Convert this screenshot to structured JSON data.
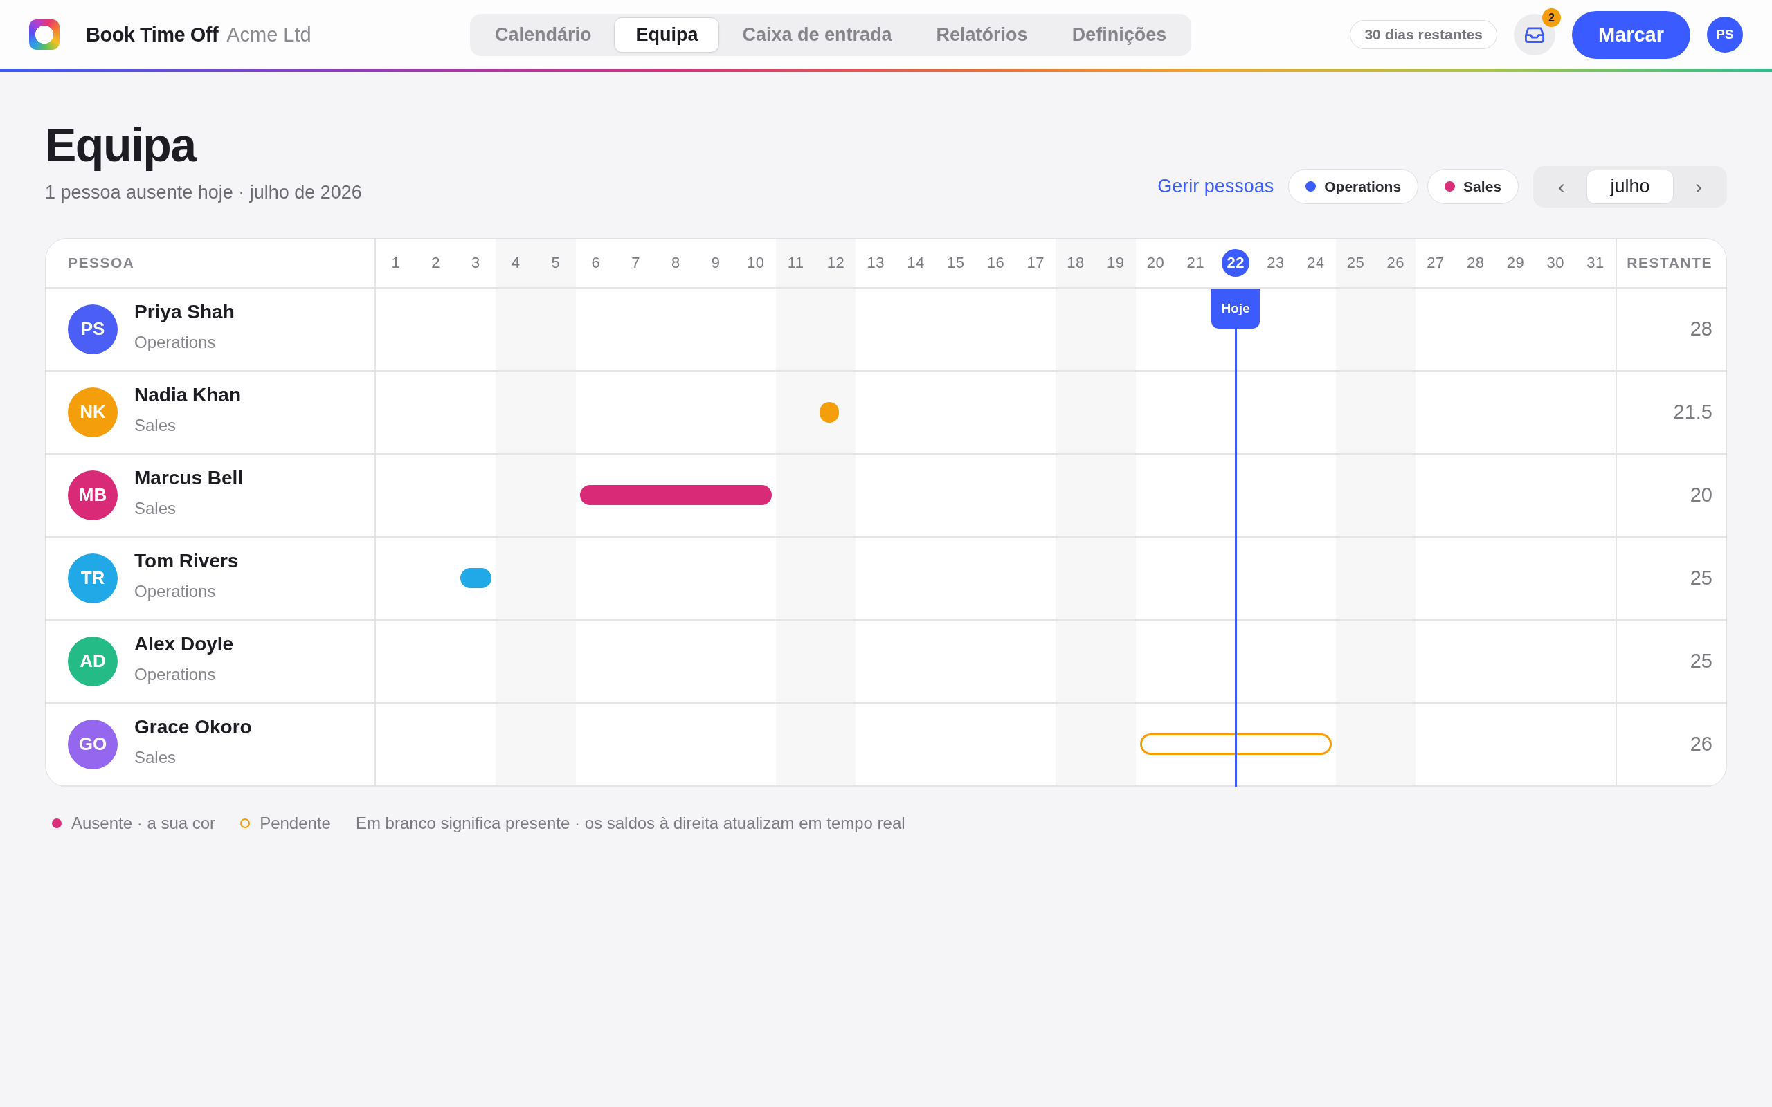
{
  "app": {
    "name": "Book Time Off",
    "org": "Acme Ltd"
  },
  "tabs": [
    {
      "label": "Calendário",
      "selected": false
    },
    {
      "label": "Equipa",
      "selected": true
    },
    {
      "label": "Caixa de entrada",
      "selected": false
    },
    {
      "label": "Relatórios",
      "selected": false
    },
    {
      "label": "Definições",
      "selected": false
    }
  ],
  "days_left": "30 dias restantes",
  "inbox": {
    "badge": "2"
  },
  "primary_action": "Marcar",
  "user": {
    "initials": "PS"
  },
  "page": {
    "title": "Equipa",
    "subtitle": "1 pessoa ausente hoje · julho de 2026"
  },
  "manage_link": "Gerir pessoas",
  "filters": [
    {
      "label": "Operations",
      "color": "#3b5bfd"
    },
    {
      "label": "Sales",
      "color": "#d92f7a"
    }
  ],
  "month_nav": {
    "prev": "‹",
    "month": "julho",
    "next": "›"
  },
  "table": {
    "person_header": "PESSOA",
    "remaining_header": "RESTANTE",
    "today_label": "Hoje"
  },
  "days": [
    {
      "label": "1",
      "weekend": false,
      "today": false
    },
    {
      "label": "2",
      "weekend": false,
      "today": false
    },
    {
      "label": "3",
      "weekend": false,
      "today": false
    },
    {
      "label": "4",
      "weekend": true,
      "today": false
    },
    {
      "label": "5",
      "weekend": true,
      "today": false
    },
    {
      "label": "6",
      "weekend": false,
      "today": false
    },
    {
      "label": "7",
      "weekend": false,
      "today": false
    },
    {
      "label": "8",
      "weekend": false,
      "today": false
    },
    {
      "label": "9",
      "weekend": false,
      "today": false
    },
    {
      "label": "10",
      "weekend": false,
      "today": false
    },
    {
      "label": "11",
      "weekend": true,
      "today": false
    },
    {
      "label": "12",
      "weekend": true,
      "today": false
    },
    {
      "label": "13",
      "weekend": false,
      "today": false
    },
    {
      "label": "14",
      "weekend": false,
      "today": false
    },
    {
      "label": "15",
      "weekend": false,
      "today": false
    },
    {
      "label": "16",
      "weekend": false,
      "today": false
    },
    {
      "label": "17",
      "weekend": false,
      "today": false
    },
    {
      "label": "18",
      "weekend": true,
      "today": false
    },
    {
      "label": "19",
      "weekend": true,
      "today": false
    },
    {
      "label": "20",
      "weekend": false,
      "today": false
    },
    {
      "label": "21",
      "weekend": false,
      "today": false
    },
    {
      "label": "22",
      "weekend": false,
      "today": true
    },
    {
      "label": "23",
      "weekend": false,
      "today": false
    },
    {
      "label": "24",
      "weekend": false,
      "today": false
    },
    {
      "label": "25",
      "weekend": true,
      "today": false
    },
    {
      "label": "26",
      "weekend": true,
      "today": false
    },
    {
      "label": "27",
      "weekend": false,
      "today": false
    },
    {
      "label": "28",
      "weekend": false,
      "today": false
    },
    {
      "label": "29",
      "weekend": false,
      "today": false
    },
    {
      "label": "30",
      "weekend": false,
      "today": false
    },
    {
      "label": "31",
      "weekend": false,
      "today": false
    }
  ],
  "people": [
    {
      "initials": "PS",
      "name": "Priya Shah",
      "department": "Operations",
      "color": "#4b5ef5",
      "remaining": "28",
      "timeline": [
        {
          "kind": "free"
        },
        {
          "kind": "free"
        },
        {
          "kind": "free"
        },
        {
          "kind": "free"
        },
        {
          "kind": "free"
        },
        {
          "kind": "free"
        },
        {
          "kind": "free"
        },
        {
          "kind": "free"
        },
        {
          "kind": "free"
        },
        {
          "kind": "free"
        },
        {
          "kind": "free"
        },
        {
          "kind": "free"
        },
        {
          "kind": "free"
        },
        {
          "kind": "free"
        },
        {
          "kind": "free"
        },
        {
          "kind": "free"
        },
        {
          "kind": "free"
        },
        {
          "kind": "free"
        },
        {
          "kind": "free"
        },
        {
          "kind": "free"
        },
        {
          "kind": "free"
        },
        {
          "kind": "free"
        },
        {
          "kind": "free"
        },
        {
          "kind": "free"
        },
        {
          "kind": "free"
        },
        {
          "kind": "free"
        },
        {
          "kind": "free"
        },
        {
          "kind": "free"
        },
        {
          "kind": "free"
        },
        {
          "kind": "free"
        },
        {
          "kind": "free"
        }
      ]
    },
    {
      "initials": "NK",
      "name": "Nadia Khan",
      "department": "Sales",
      "color": "#f59e0b",
      "remaining": "21.5",
      "timeline": [
        {
          "kind": "free"
        },
        {
          "kind": "free"
        },
        {
          "kind": "free"
        },
        {
          "kind": "free"
        },
        {
          "kind": "free"
        },
        {
          "kind": "free"
        },
        {
          "kind": "free"
        },
        {
          "kind": "free"
        },
        {
          "kind": "free"
        },
        {
          "kind": "free"
        },
        {
          "kind": "free"
        },
        {
          "kind": "half"
        },
        {
          "kind": "free"
        },
        {
          "kind": "free"
        },
        {
          "kind": "free"
        },
        {
          "kind": "free"
        },
        {
          "kind": "free"
        },
        {
          "kind": "free"
        },
        {
          "kind": "free"
        },
        {
          "kind": "free"
        },
        {
          "kind": "free"
        },
        {
          "kind": "free"
        },
        {
          "kind": "free"
        },
        {
          "kind": "free"
        },
        {
          "kind": "free"
        },
        {
          "kind": "free"
        },
        {
          "kind": "free"
        },
        {
          "kind": "free"
        },
        {
          "kind": "free"
        },
        {
          "kind": "free"
        },
        {
          "kind": "free"
        }
      ]
    },
    {
      "initials": "MB",
      "name": "Marcus Bell",
      "department": "Sales",
      "color": "#d92a78",
      "remaining": "20",
      "timeline": [
        {
          "kind": "free"
        },
        {
          "kind": "free"
        },
        {
          "kind": "free"
        },
        {
          "kind": "free"
        },
        {
          "kind": "free"
        },
        {
          "kind": "absent"
        },
        {
          "kind": "absent"
        },
        {
          "kind": "absent"
        },
        {
          "kind": "absent"
        },
        {
          "kind": "absent"
        },
        {
          "kind": "free"
        },
        {
          "kind": "free"
        },
        {
          "kind": "free"
        },
        {
          "kind": "free"
        },
        {
          "kind": "free"
        },
        {
          "kind": "free"
        },
        {
          "kind": "free"
        },
        {
          "kind": "free"
        },
        {
          "kind": "free"
        },
        {
          "kind": "free"
        },
        {
          "kind": "free"
        },
        {
          "kind": "free"
        },
        {
          "kind": "free"
        },
        {
          "kind": "free"
        },
        {
          "kind": "free"
        },
        {
          "kind": "free"
        },
        {
          "kind": "free"
        },
        {
          "kind": "free"
        },
        {
          "kind": "free"
        },
        {
          "kind": "free"
        },
        {
          "kind": "free"
        }
      ]
    },
    {
      "initials": "TR",
      "name": "Tom Rivers",
      "department": "Operations",
      "color": "#21a8e6",
      "remaining": "25",
      "timeline": [
        {
          "kind": "free"
        },
        {
          "kind": "free"
        },
        {
          "kind": "absent"
        },
        {
          "kind": "free"
        },
        {
          "kind": "free"
        },
        {
          "kind": "free"
        },
        {
          "kind": "free"
        },
        {
          "kind": "free"
        },
        {
          "kind": "free"
        },
        {
          "kind": "free"
        },
        {
          "kind": "free"
        },
        {
          "kind": "free"
        },
        {
          "kind": "free"
        },
        {
          "kind": "free"
        },
        {
          "kind": "free"
        },
        {
          "kind": "free"
        },
        {
          "kind": "free"
        },
        {
          "kind": "free"
        },
        {
          "kind": "free"
        },
        {
          "kind": "free"
        },
        {
          "kind": "free"
        },
        {
          "kind": "free"
        },
        {
          "kind": "free"
        },
        {
          "kind": "free"
        },
        {
          "kind": "free"
        },
        {
          "kind": "free"
        },
        {
          "kind": "free"
        },
        {
          "kind": "free"
        },
        {
          "kind": "free"
        },
        {
          "kind": "free"
        },
        {
          "kind": "free"
        }
      ]
    },
    {
      "initials": "AD",
      "name": "Alex Doyle",
      "department": "Operations",
      "color": "#25bb87",
      "remaining": "25",
      "timeline": [
        {
          "kind": "free"
        },
        {
          "kind": "free"
        },
        {
          "kind": "free"
        },
        {
          "kind": "free"
        },
        {
          "kind": "free"
        },
        {
          "kind": "free"
        },
        {
          "kind": "free"
        },
        {
          "kind": "free"
        },
        {
          "kind": "free"
        },
        {
          "kind": "free"
        },
        {
          "kind": "free"
        },
        {
          "kind": "free"
        },
        {
          "kind": "free"
        },
        {
          "kind": "free"
        },
        {
          "kind": "free"
        },
        {
          "kind": "free"
        },
        {
          "kind": "free"
        },
        {
          "kind": "free"
        },
        {
          "kind": "free"
        },
        {
          "kind": "free"
        },
        {
          "kind": "free"
        },
        {
          "kind": "free"
        },
        {
          "kind": "free"
        },
        {
          "kind": "free"
        },
        {
          "kind": "free"
        },
        {
          "kind": "free"
        },
        {
          "kind": "free"
        },
        {
          "kind": "free"
        },
        {
          "kind": "free"
        },
        {
          "kind": "free"
        },
        {
          "kind": "free"
        }
      ]
    },
    {
      "initials": "GO",
      "name": "Grace Okoro",
      "department": "Sales",
      "color": "#9566ee",
      "remaining": "26",
      "timeline": [
        {
          "kind": "free"
        },
        {
          "kind": "free"
        },
        {
          "kind": "free"
        },
        {
          "kind": "free"
        },
        {
          "kind": "free"
        },
        {
          "kind": "free"
        },
        {
          "kind": "free"
        },
        {
          "kind": "free"
        },
        {
          "kind": "free"
        },
        {
          "kind": "free"
        },
        {
          "kind": "free"
        },
        {
          "kind": "free"
        },
        {
          "kind": "free"
        },
        {
          "kind": "free"
        },
        {
          "kind": "free"
        },
        {
          "kind": "free"
        },
        {
          "kind": "free"
        },
        {
          "kind": "free"
        },
        {
          "kind": "free"
        },
        {
          "kind": "pending"
        },
        {
          "kind": "pending"
        },
        {
          "kind": "pending"
        },
        {
          "kind": "pending"
        },
        {
          "kind": "pending"
        },
        {
          "kind": "free"
        },
        {
          "kind": "free"
        },
        {
          "kind": "free"
        },
        {
          "kind": "free"
        },
        {
          "kind": "free"
        },
        {
          "kind": "free"
        },
        {
          "kind": "free"
        }
      ]
    }
  ],
  "legend": [
    {
      "kind": "absent",
      "label": "Ausente · a sua cor",
      "color": "#d92f7a"
    },
    {
      "kind": "pending",
      "label": "Pendente",
      "color": "#f59e0b"
    },
    {
      "kind": "note",
      "label": "Em branco significa presente · os saldos à direita atualizam em tempo real"
    }
  ]
}
